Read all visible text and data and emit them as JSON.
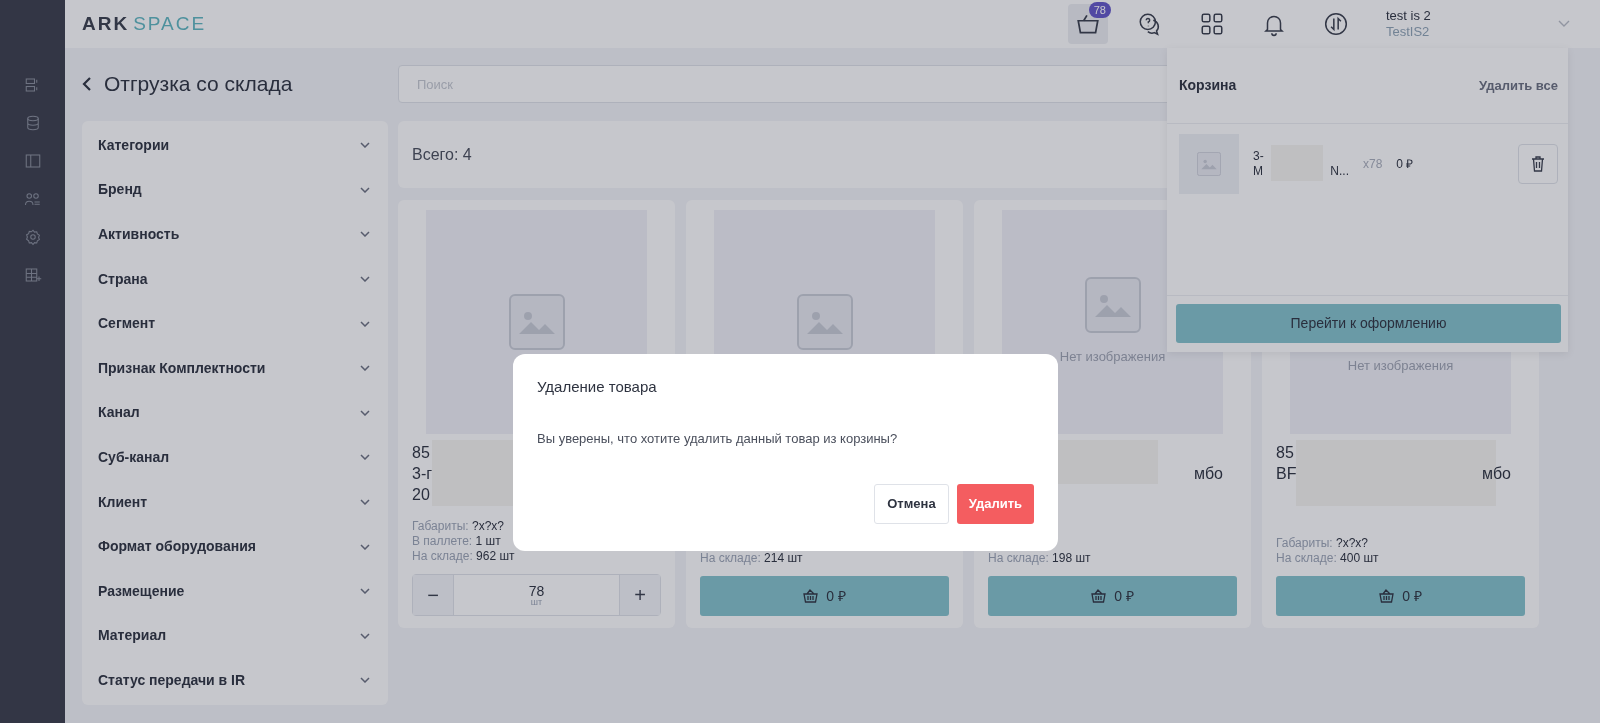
{
  "logo": {
    "part1": "ARK",
    "part2": "SPACE"
  },
  "header": {
    "cart_count": "78",
    "user_name": "test is 2",
    "user_login": "TestIS2"
  },
  "page": {
    "title": "Отгрузка со склада",
    "search": {
      "placeholder": "Поиск"
    },
    "total": "Всего: 4"
  },
  "filters": [
    {
      "label": "Категории",
      "expanded": false
    },
    {
      "label": "Бренд",
      "expanded": false
    },
    {
      "label": "Активность",
      "expanded": false
    },
    {
      "label": "Страна",
      "expanded": false
    },
    {
      "label": "Сегмент",
      "expanded": false
    },
    {
      "label": "Признак Комплектности",
      "expanded": false
    },
    {
      "label": "Канал",
      "expanded": false
    },
    {
      "label": "Суб-канал",
      "expanded": false
    },
    {
      "label": "Клиент",
      "expanded": false
    },
    {
      "label": "Формат оборудования",
      "expanded": false
    },
    {
      "label": "Размещение",
      "expanded": false
    },
    {
      "label": "Материал",
      "expanded": false
    },
    {
      "label": "Статус передачи в IR",
      "expanded": false
    }
  ],
  "products": [
    {
      "title_lines": [
        "85",
        "3-г",
        "20"
      ],
      "specs": [
        {
          "label": "Габариты:",
          "value": "?x?x?"
        },
        {
          "label": "В паллете:",
          "value": "1 шт"
        },
        {
          "label": "На складе:",
          "value": "962 шт"
        }
      ],
      "kind": "stepper",
      "minus": "−",
      "quantity": "78",
      "unit": "шт",
      "plus": "+"
    },
    {
      "specs": [
        {
          "label": "На складе:",
          "value": "214 шт"
        }
      ],
      "kind": "add",
      "price": "0 ₽"
    },
    {
      "title_lines": [
        "мбо"
      ],
      "no_image": "Нет изображения",
      "specs": [
        {
          "label": "На складе:",
          "value": "198 шт"
        }
      ],
      "kind": "add",
      "price": "0 ₽"
    },
    {
      "title_lines": [
        "85",
        "BF",
        "мбо"
      ],
      "no_image": "Нет изображения",
      "specs": [
        {
          "label": "Габариты:",
          "value": "?x?x?"
        },
        {
          "label": "На складе:",
          "value": "400 шт"
        }
      ],
      "kind": "add",
      "price": "0 ₽"
    }
  ],
  "cart": {
    "title": "Корзина",
    "clear_all": "Удалить все",
    "items": [
      {
        "line1": "3-",
        "line2_start": "M",
        "line2_end": "N...",
        "quantity": "x78",
        "price": "0 ₽"
      }
    ],
    "checkout": "Перейти к оформлению"
  },
  "modal": {
    "title": "Удаление товара",
    "message": "Вы уверены, что хотите удалить данный товар из корзины?",
    "cancel": "Отмена",
    "confirm": "Удалить"
  }
}
